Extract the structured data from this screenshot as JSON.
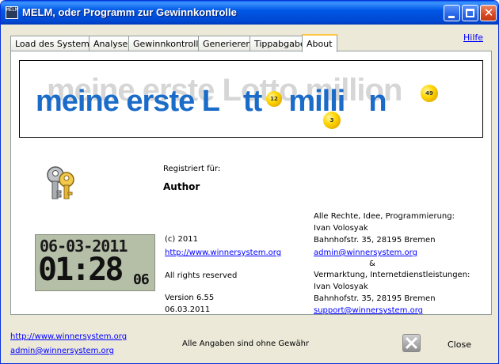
{
  "window": {
    "title": "MELM, oder Programm zur Gewinnkontrolle",
    "icon_text": "MELM"
  },
  "help_link": "Hilfe",
  "tabs": [
    {
      "label": "Load des Systems"
    },
    {
      "label": "Analyse"
    },
    {
      "label": "Gewinnkontrolle"
    },
    {
      "label": "Generieren"
    },
    {
      "label": "Tippabgabe"
    },
    {
      "label": "About",
      "active": true
    }
  ],
  "banner": {
    "shadow_text": "meine erste Lotto million",
    "text_parts": [
      "meine erste L",
      "tt",
      "milli",
      "n"
    ],
    "balls": [
      "12",
      "3",
      "49"
    ]
  },
  "about": {
    "registered_label": "Registriert für:",
    "author": "Author",
    "copyright": "(c) 2011",
    "website": "http://www.winnersystem.org",
    "rights": "All rights reserved",
    "version": "Version 6.55",
    "date": "06.03.2011"
  },
  "credits": {
    "rights_label": "Alle Rechte, Idee, Programmierung:",
    "dev_name": "Ivan Volosyak",
    "dev_address": "Bahnhofstr. 35, 28195 Bremen",
    "dev_email": "admin@winnersystem.org",
    "ampersand": "&",
    "marketing_label": "Vermarktung, Internetdienstleistungen:",
    "marketing_name": "Ivan Volosyak",
    "marketing_address": "Bahnhofstr. 35, 28195 Bremen",
    "marketing_email": "support@winnersystem.org"
  },
  "clock": {
    "date": "06-03-2011",
    "time": "01:28",
    "seconds": "06"
  },
  "footer": {
    "website": "http://www.winnersystem.org",
    "email": "admin@winnersystem.org",
    "disclaimer": "Alle Angaben sind ohne Gewähr",
    "close_label": "Close"
  },
  "colors": {
    "title_bar": "#0058E6",
    "logo_blue": "#1B6CC9",
    "link": "#0000FF",
    "lcd_bg": "#B5BFA8"
  }
}
